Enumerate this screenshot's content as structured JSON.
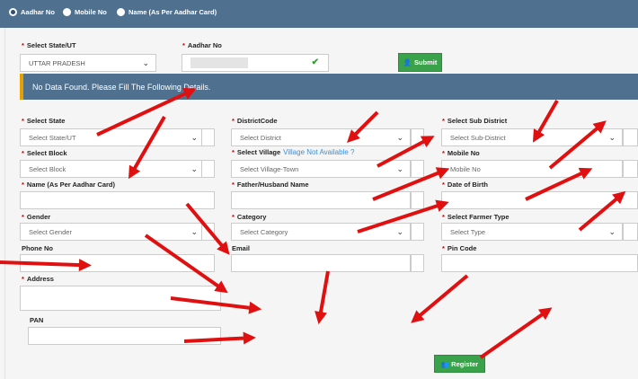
{
  "search_modes": [
    "Aadhar No",
    "Mobile No",
    "Name (As Per Aadhar Card)"
  ],
  "lookup": {
    "state_label": "Select State/UT",
    "state_value": "UTTAR PRADESH",
    "aadhar_label": "Aadhar No",
    "submit_label": "Submit"
  },
  "banner_text": "No Data Found. Please Fill The Following Details.",
  "form": {
    "state_label": "Select State",
    "state_placeholder": "Select State/UT",
    "district_label": "DistrictCode",
    "district_placeholder": "Select District",
    "subdistrict_label": "Select Sub District",
    "subdistrict_placeholder": "Select Sub-District",
    "block_label": "Select Block",
    "block_placeholder": "Select Block",
    "village_label": "Select Village",
    "village_link": "Village Not Available ?",
    "village_placeholder": "Select Village-Town",
    "mobile_label": "Mobile No",
    "mobile_placeholder": "Mobile No",
    "name_label": "Name (As Per Aadhar Card)",
    "father_label": "Father/Husband Name",
    "dob_label": "Date of Birth",
    "gender_label": "Gender",
    "gender_placeholder": "Select Gender",
    "category_label": "Category",
    "category_placeholder": "Select Category",
    "farmer_type_label": "Select Farmer Type",
    "farmer_type_placeholder": "Select Type",
    "phone_label": "Phone No",
    "email_label": "Email",
    "pin_label": "Pin Code",
    "address_label": "Address",
    "pan_label": "PAN",
    "register_label": "Register"
  },
  "colors": {
    "header": "#4f718f",
    "accent_green": "#3aa24a",
    "arrow_red": "#e01010",
    "required": "#cc0000"
  }
}
